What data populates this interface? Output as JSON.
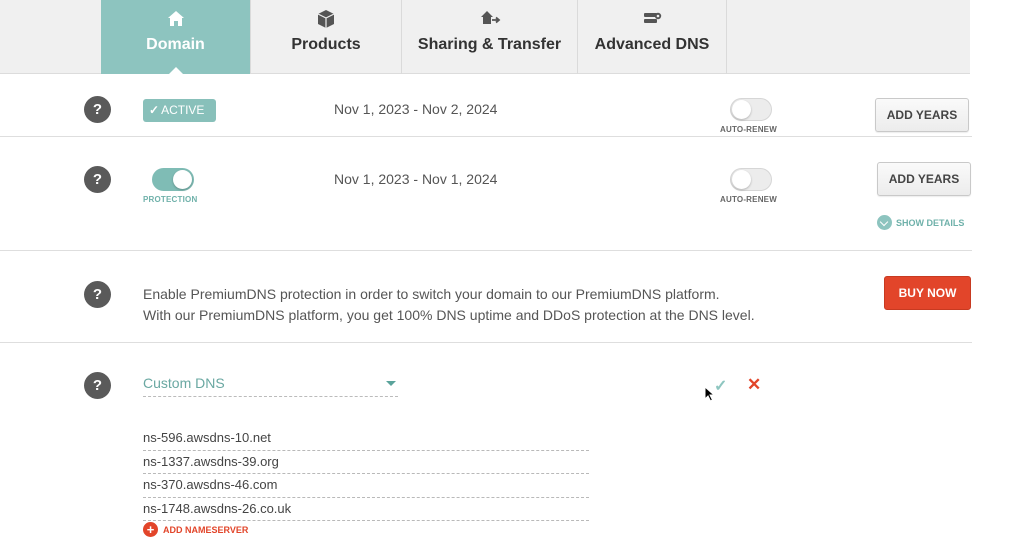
{
  "tabs": [
    {
      "label": "Domain",
      "icon": "home-icon",
      "active": true
    },
    {
      "label": "Products",
      "icon": "box-icon",
      "active": false
    },
    {
      "label": "Sharing & Transfer",
      "icon": "transfer-icon",
      "active": false
    },
    {
      "label": "Advanced DNS",
      "icon": "dns-server-icon",
      "active": false
    }
  ],
  "status_row": {
    "help": "?",
    "badge": "ACTIVE",
    "dates": "Nov 1, 2023 - Nov 2, 2024",
    "auto_renew_label": "AUTO-RENEW",
    "auto_renew_on": false,
    "button": "ADD YEARS"
  },
  "protection_row": {
    "help": "?",
    "protection_label": "PROTECTION",
    "protection_on": true,
    "dates": "Nov 1, 2023 - Nov 1, 2024",
    "auto_renew_label": "AUTO-RENEW",
    "auto_renew_on": false,
    "button": "ADD YEARS",
    "show_details": "SHOW DETAILS"
  },
  "premium_row": {
    "help": "?",
    "line1": "Enable PremiumDNS protection in order to switch your domain to our PremiumDNS platform.",
    "line2": "With our PremiumDNS platform, you get 100% DNS uptime and DDoS protection at the DNS level.",
    "button": "BUY NOW"
  },
  "nameservers": {
    "help": "?",
    "mode": "Custom DNS",
    "items": [
      "ns-596.awsdns-10.net",
      "ns-1337.awsdns-39.org",
      "ns-370.awsdns-46.com",
      "ns-1748.awsdns-26.co.uk"
    ],
    "add_label": "ADD NAMESERVER"
  },
  "colors": {
    "teal": "#8dc4bf",
    "red": "#e2452a",
    "dark_grey": "#5a5a5a"
  }
}
